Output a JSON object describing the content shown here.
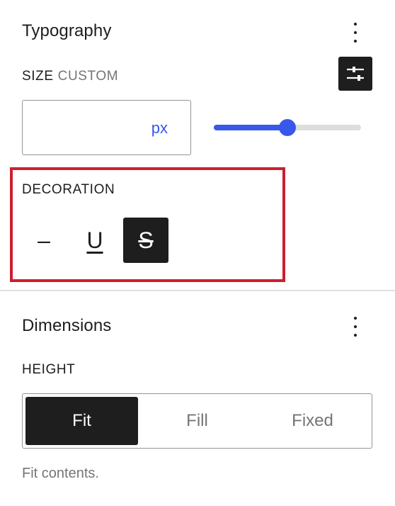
{
  "typography": {
    "title": "Typography",
    "size_label": "SIZE",
    "size_mode": "CUSTOM",
    "size_value": "",
    "size_unit": "px",
    "slider_fraction": 0.5,
    "decoration_label": "DECORATION",
    "decoration_options": [
      {
        "symbol": "–",
        "name": "none",
        "selected": false
      },
      {
        "symbol": "U",
        "name": "underline",
        "selected": false
      },
      {
        "symbol": "S",
        "name": "strikethrough",
        "selected": true
      }
    ]
  },
  "dimensions": {
    "title": "Dimensions",
    "height_label": "HEIGHT",
    "options": [
      "Fit",
      "Fill",
      "Fixed"
    ],
    "selected": "Fit",
    "help": "Fit contents."
  },
  "colors": {
    "accent": "#3858e9",
    "highlight": "#cc1f2f",
    "dark": "#1e1e1e"
  },
  "icons": {
    "menu": "more-vertical-icon",
    "settings": "sliders-icon"
  }
}
